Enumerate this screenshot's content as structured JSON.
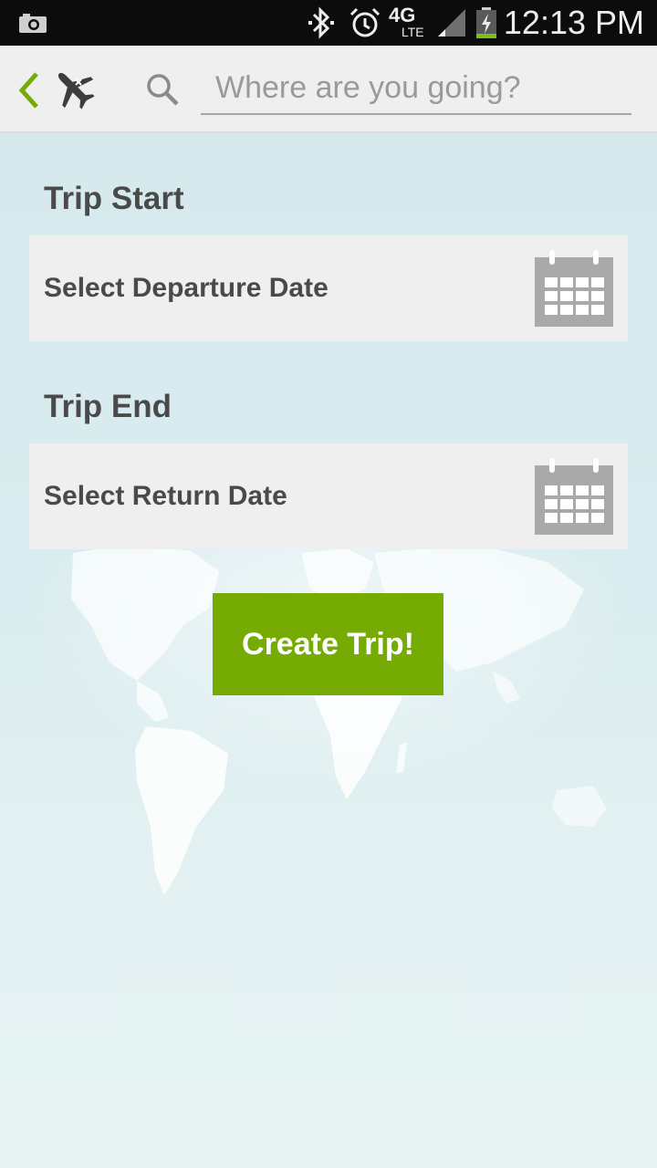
{
  "status_bar": {
    "time": "12:13 PM",
    "network": "4G",
    "network_sub": "LTE",
    "icons": [
      "camera-icon",
      "bluetooth-icon",
      "alarm-icon",
      "network-4g-lte-icon",
      "signal-icon",
      "battery-charging-icon"
    ]
  },
  "action_bar": {
    "back_icon": "chevron-left-icon",
    "app_icon": "airplane-icon",
    "search_icon": "search-icon",
    "search_placeholder": "Where are you going?",
    "search_value": ""
  },
  "form": {
    "trip_start_label": "Trip Start",
    "departure_placeholder": "Select Departure Date",
    "trip_end_label": "Trip End",
    "return_placeholder": "Select Return Date",
    "calendar_icon": "calendar-icon",
    "create_button": "Create Trip!"
  },
  "colors": {
    "accent": "#76ab03",
    "background": "#d6e9ed",
    "row_background": "#efefef",
    "text_dark": "#4a4a4a",
    "calendar_gray": "#a9a9a9"
  }
}
